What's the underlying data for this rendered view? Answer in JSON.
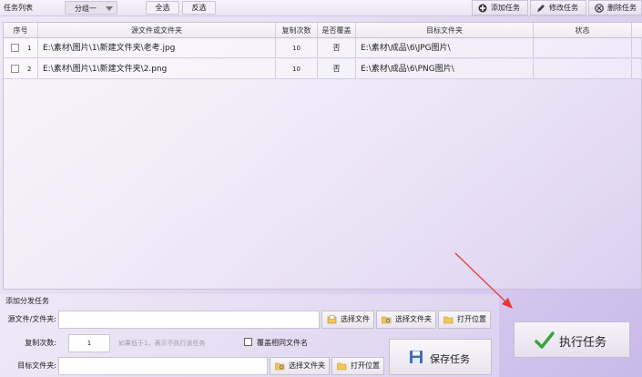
{
  "toolbar": {
    "title": "任务列表",
    "group_select": "分组一",
    "select_all": "全选",
    "invert_select": "反选",
    "add_task": "添加任务",
    "edit_task": "修改任务",
    "delete_task": "删除任务"
  },
  "table": {
    "columns": [
      "序号",
      "源文件或文件夹",
      "复制次数",
      "是否覆盖",
      "目标文件夹",
      "状态"
    ],
    "rows": [
      {
        "index": "1",
        "source": "E:\\素材\\图片\\1\\新建文件夹\\老考.jpg",
        "count": "10",
        "overwrite": "否",
        "target": "E:\\素材\\成品\\6\\JPG图片\\",
        "status": ""
      },
      {
        "index": "2",
        "source": "E:\\素材\\图片\\1\\新建文件夹\\2.png",
        "count": "10",
        "overwrite": "否",
        "target": "E:\\素材\\成品\\6\\PNG图片\\",
        "status": ""
      }
    ]
  },
  "panel": {
    "title": "添加分发任务",
    "source_label": "源文件/文件夹:",
    "source_value": "",
    "choose_file": "选择文件",
    "choose_folder": "选择文件夹",
    "open_location": "打开位置",
    "copy_count_label": "复制次数:",
    "copy_count_value": "1",
    "copy_hint": "如果低于1，表示不执行该任务",
    "overwrite_label": "覆盖相同文件名",
    "target_label": "目标文件夹:",
    "target_value": "",
    "choose_folder2": "选择文件夹",
    "open_location2": "打开位置",
    "save_task": "保存任务"
  },
  "run_button": "执行任务",
  "colors": {
    "accent_check": "#3aa43a",
    "arrow": "#e53935"
  }
}
